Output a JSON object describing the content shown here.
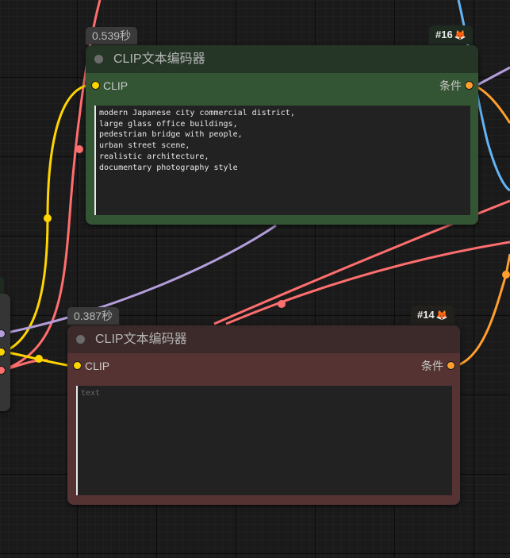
{
  "canvas": {
    "colors": {
      "clip_wire": "#ffd500",
      "conditioning_wire": "#ff9f2e",
      "model_wire": "#b39ddb",
      "vae_wire": "#ff6e6e",
      "latent_wire": "#64b5f6"
    }
  },
  "nodes": [
    {
      "id_label": "#16",
      "badge_icon": "fox-icon",
      "timing": "0.539秒",
      "title": "CLIP文本编码器",
      "input_label": "CLIP",
      "output_label": "条件",
      "text": "modern Japanese city commercial district,\nlarge glass office buildings,\npedestrian bridge with people,\nurban street scene,\nrealistic architecture,\ndocumentary photography style",
      "placeholder": "text",
      "title_color": "#263626",
      "body_color": "#335533"
    },
    {
      "id_label": "#14",
      "badge_icon": "fox-icon",
      "timing": "0.387秒",
      "title": "CLIP文本编码器",
      "input_label": "CLIP",
      "output_label": "条件",
      "text": "",
      "placeholder": "text",
      "title_color": "#3b2a29",
      "body_color": "#553333"
    }
  ]
}
